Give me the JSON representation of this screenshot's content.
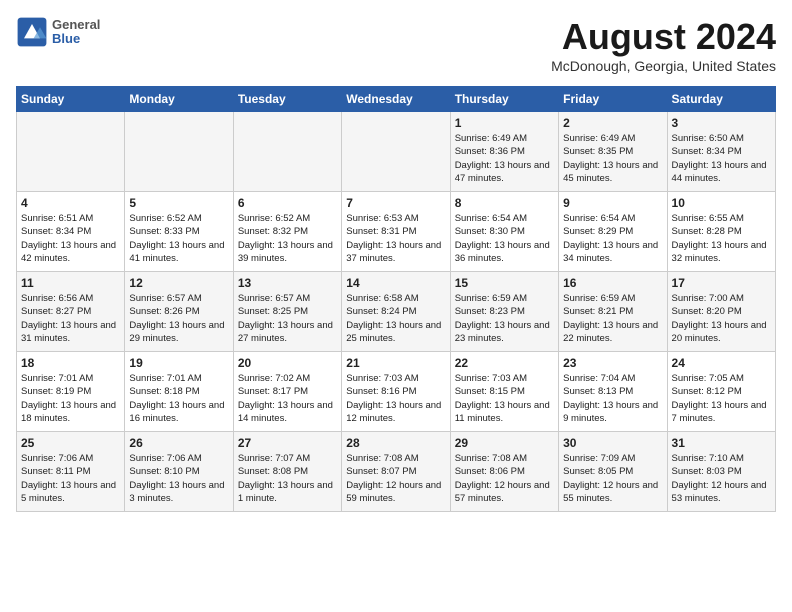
{
  "header": {
    "logo_line1": "General",
    "logo_line2": "Blue",
    "month_title": "August 2024",
    "location": "McDonough, Georgia, United States"
  },
  "weekdays": [
    "Sunday",
    "Monday",
    "Tuesday",
    "Wednesday",
    "Thursday",
    "Friday",
    "Saturday"
  ],
  "weeks": [
    [
      {
        "day": "",
        "sunrise": "",
        "sunset": "",
        "daylight": ""
      },
      {
        "day": "",
        "sunrise": "",
        "sunset": "",
        "daylight": ""
      },
      {
        "day": "",
        "sunrise": "",
        "sunset": "",
        "daylight": ""
      },
      {
        "day": "",
        "sunrise": "",
        "sunset": "",
        "daylight": ""
      },
      {
        "day": "1",
        "sunrise": "Sunrise: 6:49 AM",
        "sunset": "Sunset: 8:36 PM",
        "daylight": "Daylight: 13 hours and 47 minutes."
      },
      {
        "day": "2",
        "sunrise": "Sunrise: 6:49 AM",
        "sunset": "Sunset: 8:35 PM",
        "daylight": "Daylight: 13 hours and 45 minutes."
      },
      {
        "day": "3",
        "sunrise": "Sunrise: 6:50 AM",
        "sunset": "Sunset: 8:34 PM",
        "daylight": "Daylight: 13 hours and 44 minutes."
      }
    ],
    [
      {
        "day": "4",
        "sunrise": "Sunrise: 6:51 AM",
        "sunset": "Sunset: 8:34 PM",
        "daylight": "Daylight: 13 hours and 42 minutes."
      },
      {
        "day": "5",
        "sunrise": "Sunrise: 6:52 AM",
        "sunset": "Sunset: 8:33 PM",
        "daylight": "Daylight: 13 hours and 41 minutes."
      },
      {
        "day": "6",
        "sunrise": "Sunrise: 6:52 AM",
        "sunset": "Sunset: 8:32 PM",
        "daylight": "Daylight: 13 hours and 39 minutes."
      },
      {
        "day": "7",
        "sunrise": "Sunrise: 6:53 AM",
        "sunset": "Sunset: 8:31 PM",
        "daylight": "Daylight: 13 hours and 37 minutes."
      },
      {
        "day": "8",
        "sunrise": "Sunrise: 6:54 AM",
        "sunset": "Sunset: 8:30 PM",
        "daylight": "Daylight: 13 hours and 36 minutes."
      },
      {
        "day": "9",
        "sunrise": "Sunrise: 6:54 AM",
        "sunset": "Sunset: 8:29 PM",
        "daylight": "Daylight: 13 hours and 34 minutes."
      },
      {
        "day": "10",
        "sunrise": "Sunrise: 6:55 AM",
        "sunset": "Sunset: 8:28 PM",
        "daylight": "Daylight: 13 hours and 32 minutes."
      }
    ],
    [
      {
        "day": "11",
        "sunrise": "Sunrise: 6:56 AM",
        "sunset": "Sunset: 8:27 PM",
        "daylight": "Daylight: 13 hours and 31 minutes."
      },
      {
        "day": "12",
        "sunrise": "Sunrise: 6:57 AM",
        "sunset": "Sunset: 8:26 PM",
        "daylight": "Daylight: 13 hours and 29 minutes."
      },
      {
        "day": "13",
        "sunrise": "Sunrise: 6:57 AM",
        "sunset": "Sunset: 8:25 PM",
        "daylight": "Daylight: 13 hours and 27 minutes."
      },
      {
        "day": "14",
        "sunrise": "Sunrise: 6:58 AM",
        "sunset": "Sunset: 8:24 PM",
        "daylight": "Daylight: 13 hours and 25 minutes."
      },
      {
        "day": "15",
        "sunrise": "Sunrise: 6:59 AM",
        "sunset": "Sunset: 8:23 PM",
        "daylight": "Daylight: 13 hours and 23 minutes."
      },
      {
        "day": "16",
        "sunrise": "Sunrise: 6:59 AM",
        "sunset": "Sunset: 8:21 PM",
        "daylight": "Daylight: 13 hours and 22 minutes."
      },
      {
        "day": "17",
        "sunrise": "Sunrise: 7:00 AM",
        "sunset": "Sunset: 8:20 PM",
        "daylight": "Daylight: 13 hours and 20 minutes."
      }
    ],
    [
      {
        "day": "18",
        "sunrise": "Sunrise: 7:01 AM",
        "sunset": "Sunset: 8:19 PM",
        "daylight": "Daylight: 13 hours and 18 minutes."
      },
      {
        "day": "19",
        "sunrise": "Sunrise: 7:01 AM",
        "sunset": "Sunset: 8:18 PM",
        "daylight": "Daylight: 13 hours and 16 minutes."
      },
      {
        "day": "20",
        "sunrise": "Sunrise: 7:02 AM",
        "sunset": "Sunset: 8:17 PM",
        "daylight": "Daylight: 13 hours and 14 minutes."
      },
      {
        "day": "21",
        "sunrise": "Sunrise: 7:03 AM",
        "sunset": "Sunset: 8:16 PM",
        "daylight": "Daylight: 13 hours and 12 minutes."
      },
      {
        "day": "22",
        "sunrise": "Sunrise: 7:03 AM",
        "sunset": "Sunset: 8:15 PM",
        "daylight": "Daylight: 13 hours and 11 minutes."
      },
      {
        "day": "23",
        "sunrise": "Sunrise: 7:04 AM",
        "sunset": "Sunset: 8:13 PM",
        "daylight": "Daylight: 13 hours and 9 minutes."
      },
      {
        "day": "24",
        "sunrise": "Sunrise: 7:05 AM",
        "sunset": "Sunset: 8:12 PM",
        "daylight": "Daylight: 13 hours and 7 minutes."
      }
    ],
    [
      {
        "day": "25",
        "sunrise": "Sunrise: 7:06 AM",
        "sunset": "Sunset: 8:11 PM",
        "daylight": "Daylight: 13 hours and 5 minutes."
      },
      {
        "day": "26",
        "sunrise": "Sunrise: 7:06 AM",
        "sunset": "Sunset: 8:10 PM",
        "daylight": "Daylight: 13 hours and 3 minutes."
      },
      {
        "day": "27",
        "sunrise": "Sunrise: 7:07 AM",
        "sunset": "Sunset: 8:08 PM",
        "daylight": "Daylight: 13 hours and 1 minute."
      },
      {
        "day": "28",
        "sunrise": "Sunrise: 7:08 AM",
        "sunset": "Sunset: 8:07 PM",
        "daylight": "Daylight: 12 hours and 59 minutes."
      },
      {
        "day": "29",
        "sunrise": "Sunrise: 7:08 AM",
        "sunset": "Sunset: 8:06 PM",
        "daylight": "Daylight: 12 hours and 57 minutes."
      },
      {
        "day": "30",
        "sunrise": "Sunrise: 7:09 AM",
        "sunset": "Sunset: 8:05 PM",
        "daylight": "Daylight: 12 hours and 55 minutes."
      },
      {
        "day": "31",
        "sunrise": "Sunrise: 7:10 AM",
        "sunset": "Sunset: 8:03 PM",
        "daylight": "Daylight: 12 hours and 53 minutes."
      }
    ]
  ]
}
